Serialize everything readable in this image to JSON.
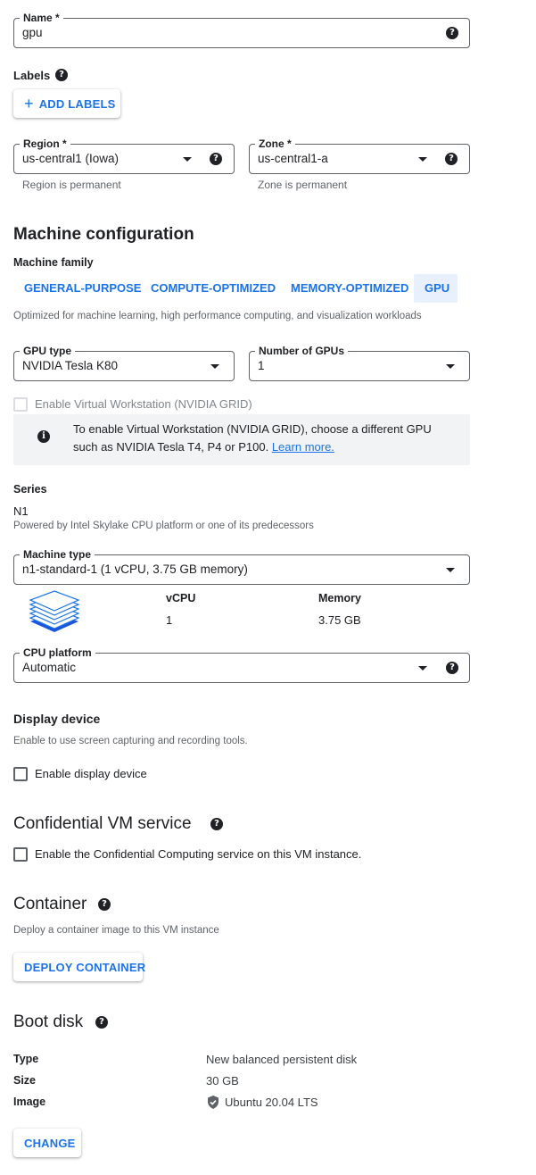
{
  "name_field": {
    "label": "Name *",
    "value": "gpu"
  },
  "labels": {
    "title": "Labels",
    "add_button": "ADD LABELS"
  },
  "region": {
    "label": "Region *",
    "value": "us-central1 (Iowa)",
    "hint": "Region is permanent"
  },
  "zone": {
    "label": "Zone *",
    "value": "us-central1-a",
    "hint": "Zone is permanent"
  },
  "machine_config": {
    "title": "Machine configuration",
    "family_label": "Machine family",
    "tabs": [
      {
        "label": "GENERAL-PURPOSE",
        "active": false
      },
      {
        "label": "COMPUTE-OPTIMIZED",
        "active": false
      },
      {
        "label": "MEMORY-OPTIMIZED",
        "active": false
      },
      {
        "label": "GPU",
        "active": true
      }
    ],
    "family_description": "Optimized for machine learning, high performance computing, and visualization workloads"
  },
  "gpu_type": {
    "label": "GPU type",
    "value": "NVIDIA Tesla K80"
  },
  "gpu_count": {
    "label": "Number of GPUs",
    "value": "1"
  },
  "virtual_workstation": {
    "label": "Enable Virtual Workstation (NVIDIA GRID)",
    "checked": false,
    "disabled": true
  },
  "info_box": {
    "text": "To enable Virtual Workstation (NVIDIA GRID), choose a different GPU such as NVIDIA Tesla T4, P4 or P100.",
    "link": "Learn more."
  },
  "series": {
    "label": "Series",
    "value": "N1",
    "description": "Powered by Intel Skylake CPU platform or one of its predecessors"
  },
  "machine_type": {
    "label": "Machine type",
    "value": "n1-standard-1 (1 vCPU, 3.75 GB memory)",
    "vcpu_header": "vCPU",
    "vcpu_value": "1",
    "memory_header": "Memory",
    "memory_value": "3.75 GB"
  },
  "cpu_platform": {
    "label": "CPU platform",
    "value": "Automatic"
  },
  "display_device": {
    "title": "Display device",
    "description": "Enable to use screen capturing and recording tools.",
    "checkbox_label": "Enable display device",
    "checked": false
  },
  "confidential_vm": {
    "title": "Confidential VM service",
    "checkbox_label": "Enable the Confidential Computing service on this VM instance.",
    "checked": false
  },
  "container": {
    "title": "Container",
    "description": "Deploy a container image to this VM instance",
    "button": "DEPLOY CONTAINER"
  },
  "boot_disk": {
    "title": "Boot disk",
    "rows": [
      {
        "key": "Type",
        "value": "New balanced persistent disk"
      },
      {
        "key": "Size",
        "value": "30 GB"
      },
      {
        "key": "Image",
        "value": "Ubuntu 20.04 LTS",
        "icon": "shield-icon"
      }
    ],
    "change_button": "CHANGE"
  },
  "colors": {
    "accent": "#1a73e8",
    "text": "#202124",
    "muted": "#5f6368",
    "info_bg": "#f1f3f4",
    "active_tab_bg": "#e8f0fe"
  }
}
